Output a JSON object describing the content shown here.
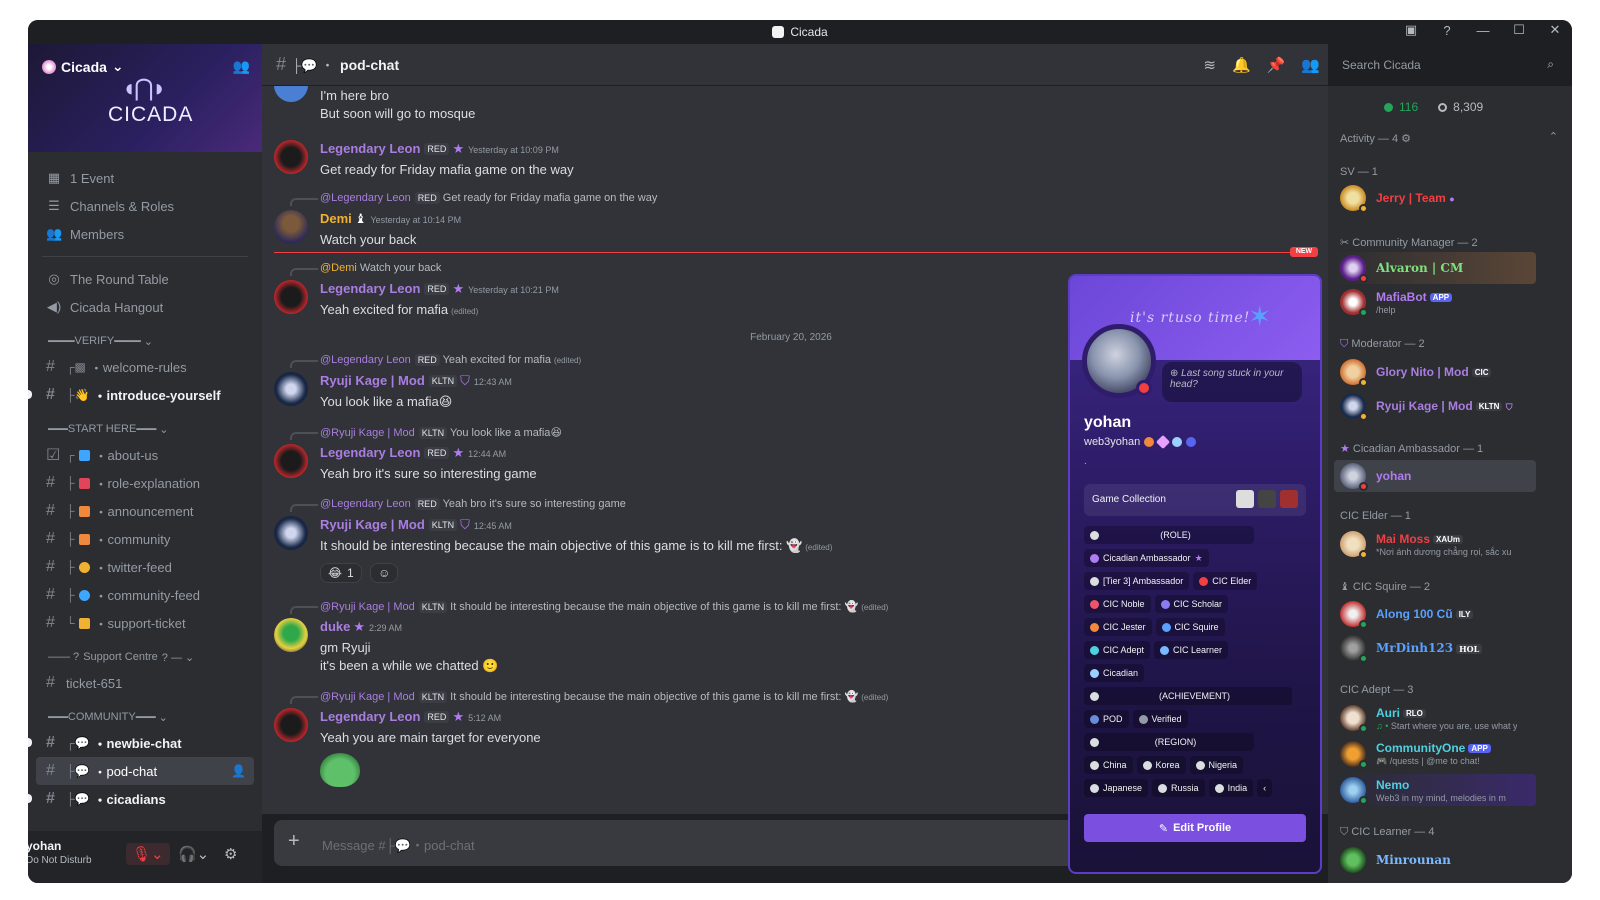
{
  "window": {
    "title": "Cicada"
  },
  "server": {
    "name": "Cicada",
    "logo_text": "CICADA"
  },
  "sidebar": {
    "nav": [
      {
        "icon": "calendar-icon",
        "label": "1 Event"
      },
      {
        "icon": "list-icon",
        "label": "Channels & Roles"
      },
      {
        "icon": "members-icon",
        "label": "Members"
      }
    ],
    "voice": [
      {
        "icon": "stage-icon",
        "label": "The Round Table"
      },
      {
        "icon": "speaker-icon",
        "label": "Cicada Hangout"
      }
    ],
    "categories": {
      "verify": "VERIFY",
      "start_here": "START HERE",
      "support": "Support Centre",
      "community": "COMMUNITY"
    },
    "channels_verify": [
      "welcome-rules",
      "introduce-yourself"
    ],
    "channels_start": [
      "about-us",
      "role-explanation",
      "announcement",
      "community",
      "twitter-feed",
      "community-feed",
      "support-ticket"
    ],
    "ticket": "ticket-651",
    "channels_community": [
      "newbie-chat",
      "pod-chat",
      "cicadians"
    ]
  },
  "user": {
    "name": "yohan",
    "status": "Do Not Disturb"
  },
  "header": {
    "channel": "pod-chat",
    "search_placeholder": "Search Cicada"
  },
  "messages": {
    "m0": {
      "line1": "I'm here bro",
      "line2": "But soon will go to mosque"
    },
    "m1": {
      "author": "Legendary Leon",
      "tag": "RED",
      "time": "Yesterday at 10:09 PM",
      "text": "Get ready for Friday mafia game on the way"
    },
    "m2": {
      "reply_name": "@Legendary Leon",
      "reply_tag": "RED",
      "reply_text": "Get ready for Friday mafia game on the way",
      "author": "Demi",
      "time": "Yesterday at 10:14 PM",
      "text": "Watch your back"
    },
    "new_label": "NEW",
    "m3": {
      "reply_name": "@Demi",
      "reply_text": "Watch your back",
      "author": "Legendary Leon",
      "tag": "RED",
      "time": "Yesterday at 10:21 PM",
      "text": "Yeah excited for mafia",
      "edited": "(edited)"
    },
    "date_divider": "February 20, 2026",
    "m4": {
      "reply_name": "@Legendary Leon",
      "reply_tag": "RED",
      "reply_text": "Yeah excited for mafia",
      "reply_edited": "(edited)",
      "author": "Ryuji Kage | Mod",
      "tag": "KLTN",
      "time": "12:43 AM",
      "text": "You look like a mafia"
    },
    "m5": {
      "reply_name": "@Ryuji Kage | Mod",
      "reply_tag": "KLTN",
      "reply_text": "You look like a mafia",
      "author": "Legendary Leon",
      "tag": "RED",
      "time": "12:44 AM",
      "text": "Yeah bro it's sure so interesting game"
    },
    "m6": {
      "reply_name": "@Legendary Leon",
      "reply_tag": "RED",
      "reply_text": "Yeah bro it's sure so interesting game",
      "author": "Ryuji Kage | Mod",
      "tag": "KLTN",
      "time": "12:45 AM",
      "text": "It should be interesting because the main objective of this game is to kill me first:",
      "edited": "(edited)",
      "reaction_count": "1"
    },
    "m7": {
      "reply_name": "@Ryuji Kage | Mod",
      "reply_tag": "KLTN",
      "reply_text": "It should be interesting because the main objective of this game is to kill me first:",
      "reply_edited": "(edited)",
      "author": "duke",
      "time": "2:29 AM",
      "text1": "gm Ryuji",
      "text2": "it's been a while we chatted"
    },
    "m8": {
      "reply_name": "@Ryuji Kage | Mod",
      "reply_tag": "KLTN",
      "reply_text": "It should be interesting because the main objective of this game is to kill me first:",
      "reply_edited": "(edited)",
      "author": "Legendary Leon",
      "tag": "RED",
      "time": "5:12 AM",
      "text": "Yeah you are main target for everyone"
    }
  },
  "composer": {
    "placeholder": "Message #├💬・pod-chat"
  },
  "profile": {
    "banner_text": "it's rtuso time!",
    "status": "Last song stuck in your head?",
    "name": "yohan",
    "username": "web3yohan",
    "dot": ".",
    "game_collection": "Game Collection",
    "roles": {
      "role_header": "(ROLE)",
      "ambassador": "Cicadian Ambassador",
      "tier3": "[Tier 3] Ambassador",
      "elder": "CIC Elder",
      "noble": "CIC Noble",
      "scholar": "CIC Scholar",
      "jester": "CIC Jester",
      "squire": "CIC Squire",
      "adept": "CIC Adept",
      "learner": "CIC Learner",
      "cicadian": "Cicadian",
      "achievement_header": "(ACHIEVEMENT)",
      "pod": "POD",
      "verified": "Verified",
      "region_header": "(REGION)",
      "china": "China",
      "korea": "Korea",
      "nigeria": "Nigeria",
      "japanese": "Japanese",
      "russia": "Russia",
      "india": "India"
    },
    "edit_button": "Edit Profile"
  },
  "members": {
    "online": "116",
    "total": "8,309",
    "activity": "Activity — 4",
    "groups": {
      "sv": "SV — 1",
      "cm": "Community Manager — 2",
      "mod": "Moderator — 2",
      "amb": "Cicadian Ambassador — 1",
      "elder": "CIC Elder — 1",
      "squire": "CIC Squire — 2",
      "adept": "CIC Adept — 3",
      "learner": "CIC Learner — 4"
    },
    "list": {
      "jerry": {
        "name": "Jerry | Team"
      },
      "alvaron": {
        "name": "Alvaron | CM"
      },
      "mafiabot": {
        "name": "MafiaBot",
        "tag": "APP",
        "sub": "/help"
      },
      "glory": {
        "name": "Glory Nito | Mod",
        "tag": "CIC"
      },
      "ryuji": {
        "name": "Ryuji Kage | Mod",
        "tag": "KLTN"
      },
      "yohan": {
        "name": "yohan"
      },
      "maimoss": {
        "name": "Mai Moss",
        "tag": "XAUm",
        "sub": "*Nơi ánh dương chẳng rọi, sắc xu"
      },
      "along": {
        "name": "Along 100 Cũ",
        "tag": "ILY"
      },
      "mrdinh": {
        "name": "MrDinh123",
        "tag": "HOL"
      },
      "auri": {
        "name": "Auri",
        "tag": "RLO",
        "sub": "Start where you are, use what y"
      },
      "community1": {
        "name": "CommunityOne",
        "tag": "APP",
        "sub": "/quests | @me to chat!"
      },
      "nemo": {
        "name": "Nemo",
        "sub": "Web3 in my mind, melodies in m"
      },
      "minrounan": {
        "name": "Minrounan"
      }
    }
  },
  "colors": {
    "accent": "#7b4fe0",
    "leon": "#a97ee0",
    "ryuji": "#a97ee0",
    "duke": "#a97ee0",
    "demi": "#f0b232",
    "danger": "#f23f43",
    "online": "#23a55a"
  }
}
